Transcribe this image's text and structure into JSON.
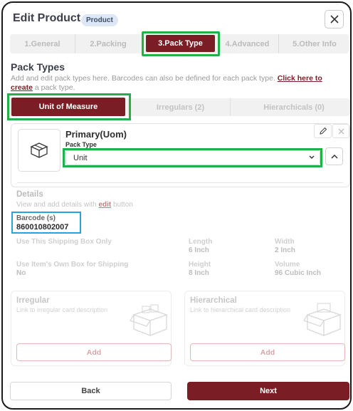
{
  "header": {
    "title": "Edit Product",
    "badge": "Product",
    "close_icon": "close-icon"
  },
  "tabs": [
    {
      "label": "1.General"
    },
    {
      "label": "2.Packing"
    },
    {
      "label": "3.Pack Type",
      "active": true
    },
    {
      "label": "4.Advanced"
    },
    {
      "label": "5.Other Info"
    }
  ],
  "pack_types": {
    "title": "Pack Types",
    "desc_prefix": "Add and edit pack types here. Barcodes can also be defined for each pack type. ",
    "desc_link": "Click here to create",
    "desc_suffix": " a pack type.",
    "subtabs": [
      {
        "label": "Unit of Measure",
        "active": true
      },
      {
        "label": "Irregulars (2)"
      },
      {
        "label": "Hierarchicals (0)"
      }
    ]
  },
  "uom_card": {
    "name": "Primary(Uom)",
    "pack_type_label": "Pack Type",
    "pack_type_value": "Unit"
  },
  "details": {
    "title": "Details",
    "desc_prefix": "View and add details with ",
    "desc_link": "edit",
    "desc_suffix": " button",
    "barcode_label": "Barcode (s)",
    "barcode_value": "860010802007",
    "fields": {
      "shipping_box_label": "Use This Shipping Box Only",
      "own_box_label": "Use Item's Own Box for Shipping",
      "own_box_value": "No",
      "length_label": "Length",
      "length_value": "6 Inch",
      "width_label": "Width",
      "width_value": "2 Inch",
      "height_label": "Height",
      "height_value": "8 Inch",
      "volume_label": "Volume",
      "volume_value": "96 Cubic Inch"
    }
  },
  "irregular_card": {
    "title": "Irregular",
    "sub": "Link to irregular card description",
    "add": "Add"
  },
  "hierarchical_card": {
    "title": "Hierarchical",
    "sub": "Link to hierarchical card description",
    "add": "Add"
  },
  "footer": {
    "back": "Back",
    "next": "Next"
  },
  "colors": {
    "brand": "#7b1d24",
    "highlight_green": "#22b04a",
    "highlight_blue": "#2aa3d8"
  }
}
